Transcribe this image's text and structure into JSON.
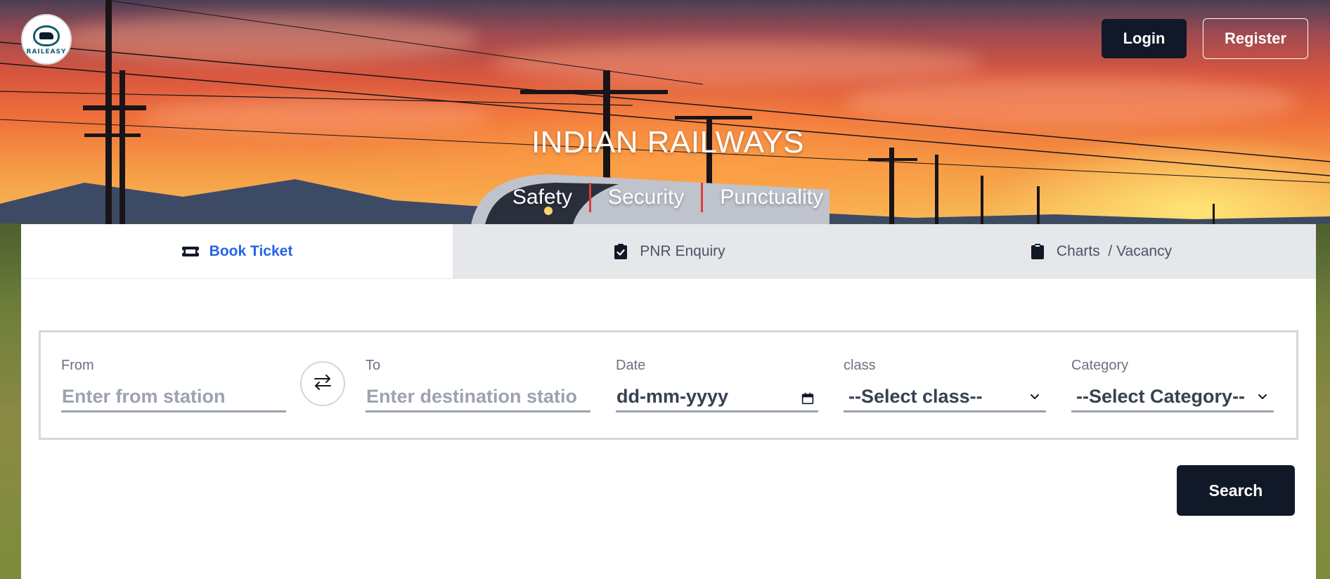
{
  "brand": {
    "logo_text": "RAILEASY"
  },
  "header": {
    "login_label": "Login",
    "register_label": "Register"
  },
  "hero": {
    "title": "INDIAN RAILWAYS",
    "taglines": [
      "Safety",
      "Security",
      "Punctuality"
    ]
  },
  "tabs": [
    {
      "label": "Book Ticket",
      "icon": "ticket-icon",
      "active": true
    },
    {
      "label": "PNR Enquiry",
      "icon": "clipboard-check-icon",
      "active": false
    },
    {
      "label": "Charts  / Vacancy",
      "icon": "clipboard-icon",
      "active": false
    }
  ],
  "form": {
    "from": {
      "label": "From",
      "placeholder": "Enter from station"
    },
    "to": {
      "label": "To",
      "placeholder": "Enter destination statio"
    },
    "date": {
      "label": "Date",
      "value": "dd-mm-yyyy"
    },
    "class": {
      "label": "class",
      "selected": "--Select class--"
    },
    "category": {
      "label": "Category",
      "selected": "--Select Category--"
    },
    "search_label": "Search"
  },
  "colors": {
    "accent_blue": "#2563eb",
    "dark_button": "#111827",
    "tagline_separator": "#e23b3b"
  }
}
